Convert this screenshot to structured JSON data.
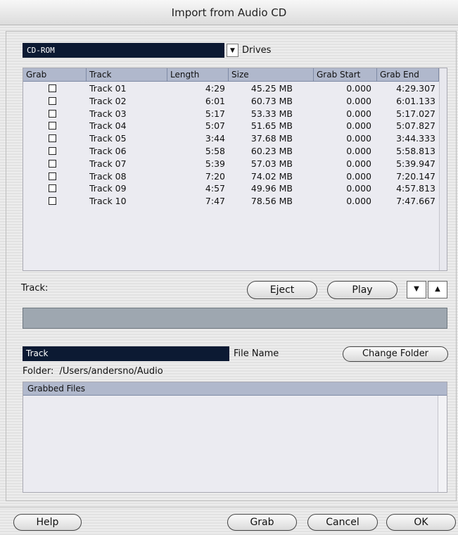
{
  "window": {
    "title": "Import from Audio CD"
  },
  "drive": {
    "selected": "CD-ROM",
    "arrow_icon": "triangle-down-icon",
    "label": "Drives"
  },
  "table": {
    "columns": [
      "Grab",
      "Track",
      "Length",
      "Size",
      "Grab Start",
      "Grab End"
    ],
    "rows": [
      {
        "track": "Track 01",
        "length": "4:29",
        "size": "45.25 MB",
        "start": "0.000",
        "end": "4:29.307"
      },
      {
        "track": "Track 02",
        "length": "6:01",
        "size": "60.73 MB",
        "start": "0.000",
        "end": "6:01.133"
      },
      {
        "track": "Track 03",
        "length": "5:17",
        "size": "53.33 MB",
        "start": "0.000",
        "end": "5:17.027"
      },
      {
        "track": "Track 04",
        "length": "5:07",
        "size": "51.65 MB",
        "start": "0.000",
        "end": "5:07.827"
      },
      {
        "track": "Track 05",
        "length": "3:44",
        "size": "37.68 MB",
        "start": "0.000",
        "end": "3:44.333"
      },
      {
        "track": "Track 06",
        "length": "5:58",
        "size": "60.23 MB",
        "start": "0.000",
        "end": "5:58.813"
      },
      {
        "track": "Track 07",
        "length": "5:39",
        "size": "57.03 MB",
        "start": "0.000",
        "end": "5:39.947"
      },
      {
        "track": "Track 08",
        "length": "7:20",
        "size": "74.02 MB",
        "start": "0.000",
        "end": "7:20.147"
      },
      {
        "track": "Track 09",
        "length": "4:57",
        "size": "49.96 MB",
        "start": "0.000",
        "end": "4:57.813"
      },
      {
        "track": "Track 10",
        "length": "7:47",
        "size": "78.56 MB",
        "start": "0.000",
        "end": "7:47.667"
      }
    ]
  },
  "controls": {
    "track_label": "Track:",
    "eject": "Eject",
    "play": "Play",
    "down_icon": "triangle-down-icon",
    "up_icon": "triangle-up-icon"
  },
  "naming": {
    "track_field": "Track",
    "file_name_label": "File Name",
    "change_folder": "Change Folder",
    "folder_label": "Folder:",
    "folder_path": "/Users/andersno/Audio"
  },
  "grabbed": {
    "header": "Grabbed Files"
  },
  "footer": {
    "help": "Help",
    "grab": "Grab",
    "cancel": "Cancel",
    "ok": "OK"
  },
  "colors": {
    "selection_field": "#0c1a33",
    "table_header": "#b0b8cc",
    "list_bg": "#ebebf1",
    "progress": "#9ea7b0"
  }
}
